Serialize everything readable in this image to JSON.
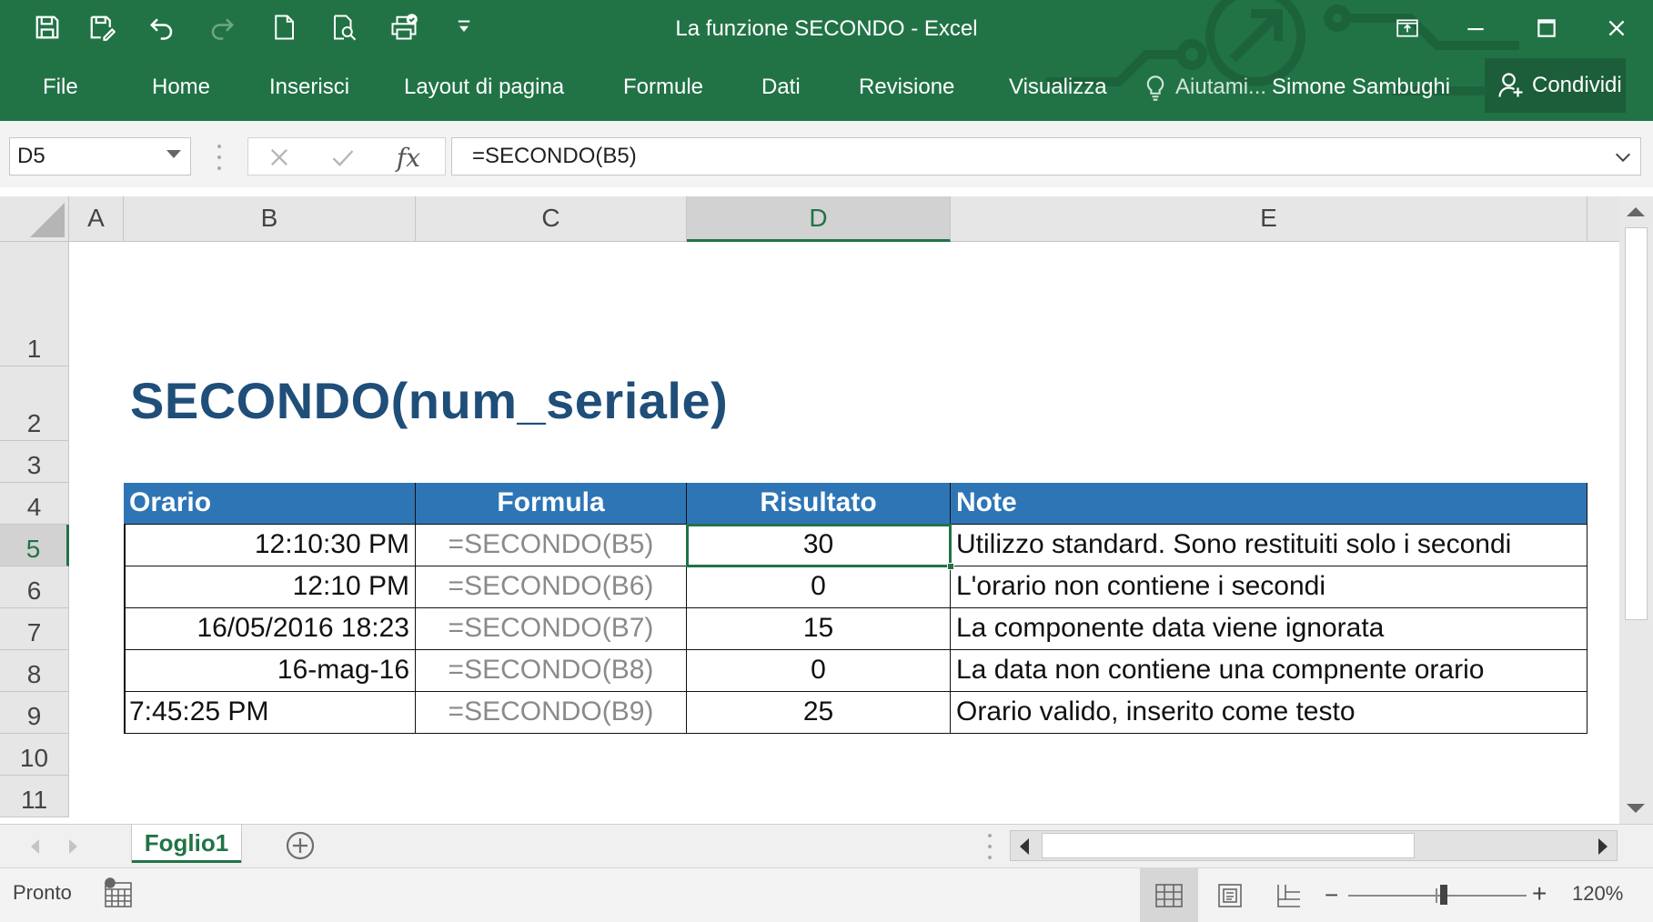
{
  "window": {
    "title": "La funzione SECONDO - Excel",
    "user": "Simone Sambughi",
    "share_label": "Condividi",
    "tell_me": "Aiutami..."
  },
  "quick_access": [
    "save-icon",
    "save-as-icon",
    "undo-icon",
    "redo-icon",
    "new-document-icon",
    "print-preview-icon",
    "quick-print-icon",
    "customize-toolbar-icon"
  ],
  "ribbon_tabs": [
    "File",
    "Home",
    "Inserisci",
    "Layout di pagina",
    "Formule",
    "Dati",
    "Revisione",
    "Visualizza"
  ],
  "formula_bar": {
    "name_box": "D5",
    "formula": "=SECONDO(B5)",
    "fx": "fx"
  },
  "columns": [
    "A",
    "B",
    "C",
    "D",
    "E"
  ],
  "selected_column": "D",
  "rows": [
    "1",
    "2",
    "3",
    "4",
    "5",
    "6",
    "7",
    "8",
    "9",
    "10",
    "11"
  ],
  "selected_row": "5",
  "sheet": {
    "heading": "SECONDO(num_seriale)",
    "table": {
      "headers": [
        "Orario",
        "Formula",
        "Risultato",
        "Note"
      ],
      "rows": [
        [
          "12:10:30 PM",
          "=SECONDO(B5)",
          "30",
          "Utilizzo standard. Sono restituiti solo i secondi"
        ],
        [
          "12:10 PM",
          "=SECONDO(B6)",
          "0",
          "L'orario non contiene i secondi"
        ],
        [
          "16/05/2016 18:23",
          "=SECONDO(B7)",
          "15",
          "La componente data viene ignorata"
        ],
        [
          "16-mag-16",
          "=SECONDO(B8)",
          "0",
          "La data non contiene una compnente orario"
        ],
        [
          "7:45:25 PM",
          "=SECONDO(B9)",
          "25",
          "Orario valido, inserito come testo"
        ]
      ]
    }
  },
  "sheet_tabs": [
    "Foglio1"
  ],
  "status": {
    "ready": "Pronto",
    "zoom": "120%"
  },
  "colors": {
    "excel_green": "#217346",
    "table_header_blue": "#2e75b6",
    "heading_blue": "#1f4e79"
  }
}
